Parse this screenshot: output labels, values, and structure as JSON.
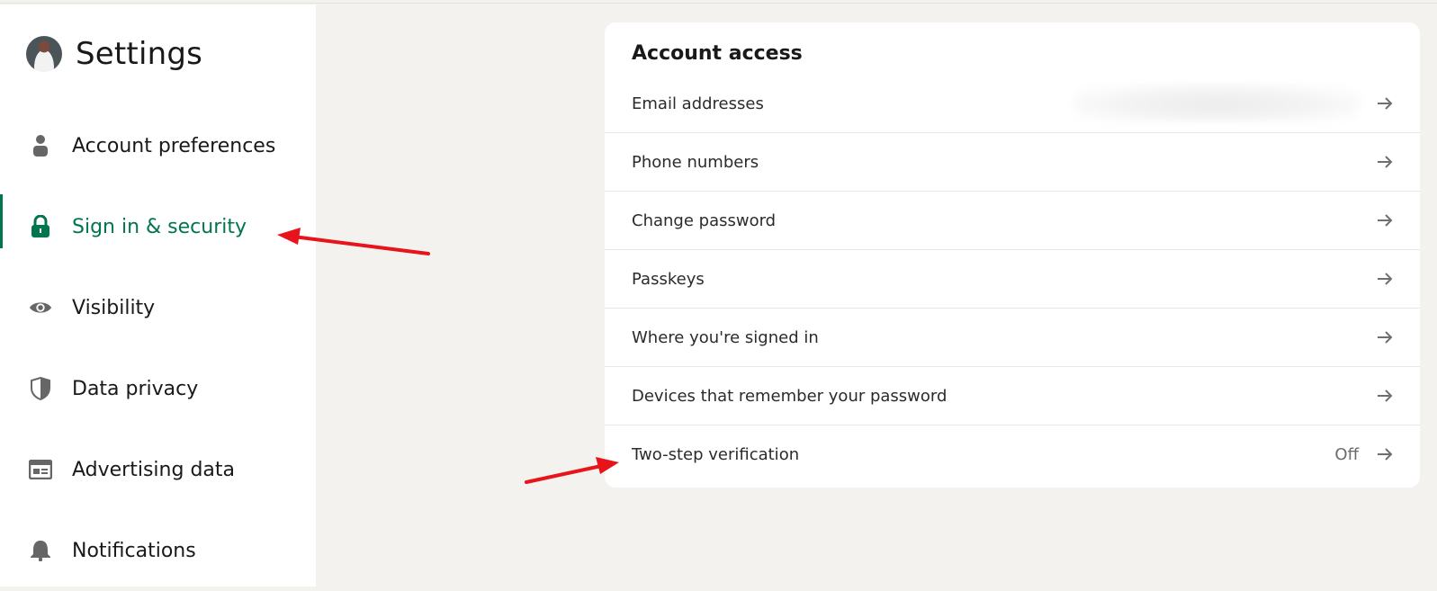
{
  "header": {
    "title": "Settings",
    "avatar_label": "Profile photo"
  },
  "sidebar": {
    "items": [
      {
        "label": "Account preferences",
        "icon": "person-icon",
        "active": false
      },
      {
        "label": "Sign in & security",
        "icon": "lock-icon",
        "active": true
      },
      {
        "label": "Visibility",
        "icon": "eye-icon",
        "active": false
      },
      {
        "label": "Data privacy",
        "icon": "shield-icon",
        "active": false
      },
      {
        "label": "Advertising data",
        "icon": "ad-card-icon",
        "active": false
      },
      {
        "label": "Notifications",
        "icon": "bell-icon",
        "active": false
      }
    ]
  },
  "main": {
    "section_title": "Account access",
    "rows": [
      {
        "label": "Email addresses",
        "value": "",
        "value_blurred": true
      },
      {
        "label": "Phone numbers",
        "value": ""
      },
      {
        "label": "Change password",
        "value": ""
      },
      {
        "label": "Passkeys",
        "value": ""
      },
      {
        "label": "Where you're signed in",
        "value": ""
      },
      {
        "label": "Devices that remember your password",
        "value": ""
      },
      {
        "label": "Two-step verification",
        "value": "Off"
      }
    ]
  },
  "colors": {
    "accent": "#01754f",
    "background": "#f3f2ef",
    "annotation_arrow": "#e8141b"
  },
  "annotations": [
    {
      "type": "arrow",
      "points_to": "Sign in & security"
    },
    {
      "type": "arrow",
      "points_to": "Two-step verification"
    }
  ]
}
